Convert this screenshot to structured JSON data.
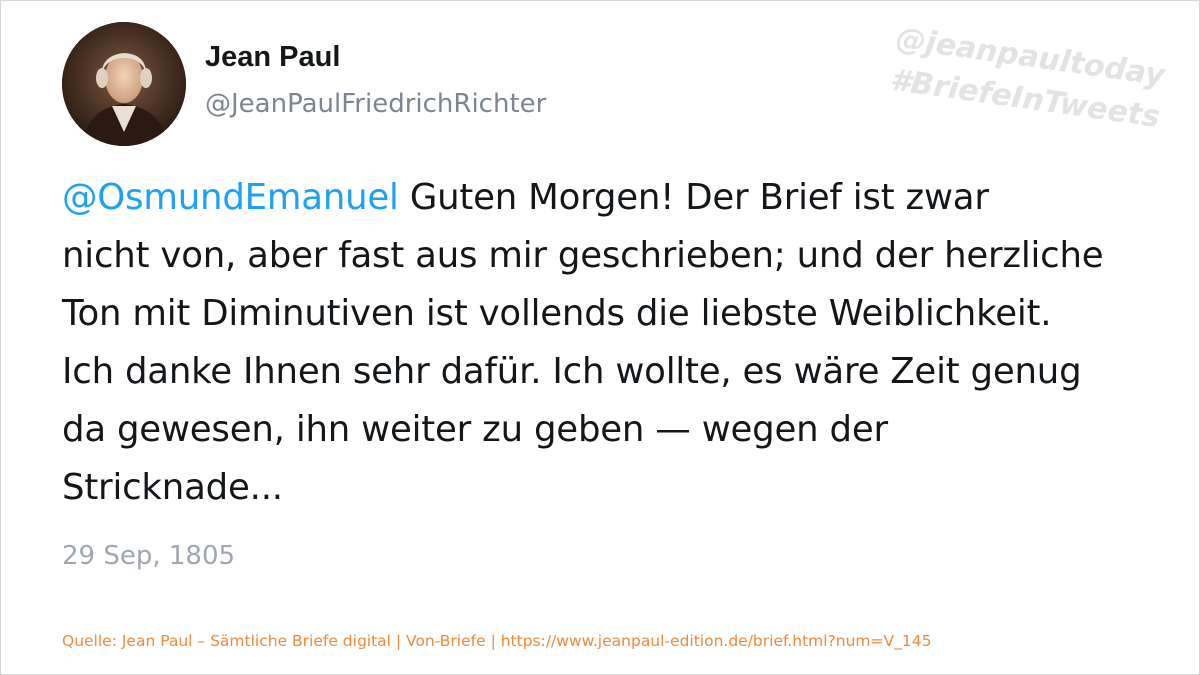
{
  "author": {
    "display_name": "Jean Paul",
    "handle": "@JeanPaulFriedrichRichter"
  },
  "watermark": {
    "line1": "@jeanpaultoday",
    "line2": "#BriefeInTweets"
  },
  "tweet": {
    "mention": "@OsmundEmanuel",
    "lines": [
      " Guten Morgen! Der Brief ist zwar",
      "nicht von, aber fast aus mir geschrieben; und der herzliche",
      "Ton mit Diminutiven ist vollends die liebste Weiblichkeit.",
      "Ich danke Ihnen sehr dafür. Ich wollte, es wäre Zeit genug",
      "da gewesen, ihn weiter zu geben — wegen der",
      "Stricknade..."
    ],
    "date": "29 Sep, 1805"
  },
  "source": "Quelle: Jean Paul – Sämtliche Briefe digital | Von-Briefe | https://www.jeanpaul-edition.de/brief.html?num=V_145",
  "colors": {
    "mention": "#1da1f2",
    "text": "#14171a",
    "muted": "#7b8692",
    "source": "#ef8a3b"
  },
  "icons": {
    "avatar": "portrait-avatar"
  }
}
